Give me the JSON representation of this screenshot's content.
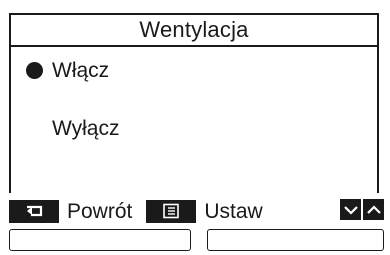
{
  "screen": {
    "title": "Wentylacja"
  },
  "options": [
    {
      "label": "Włącz",
      "selected": true
    },
    {
      "label": "Wyłącz",
      "selected": false
    }
  ],
  "footer": {
    "back_icon": "return-arrow-icon",
    "back_label": "Powrót",
    "set_icon": "menu-list-icon",
    "set_label": "Ustaw",
    "down_icon": "chevron-down-icon",
    "up_icon": "chevron-up-icon"
  },
  "colors": {
    "foreground": "#1a1a1a",
    "background": "#ffffff"
  }
}
